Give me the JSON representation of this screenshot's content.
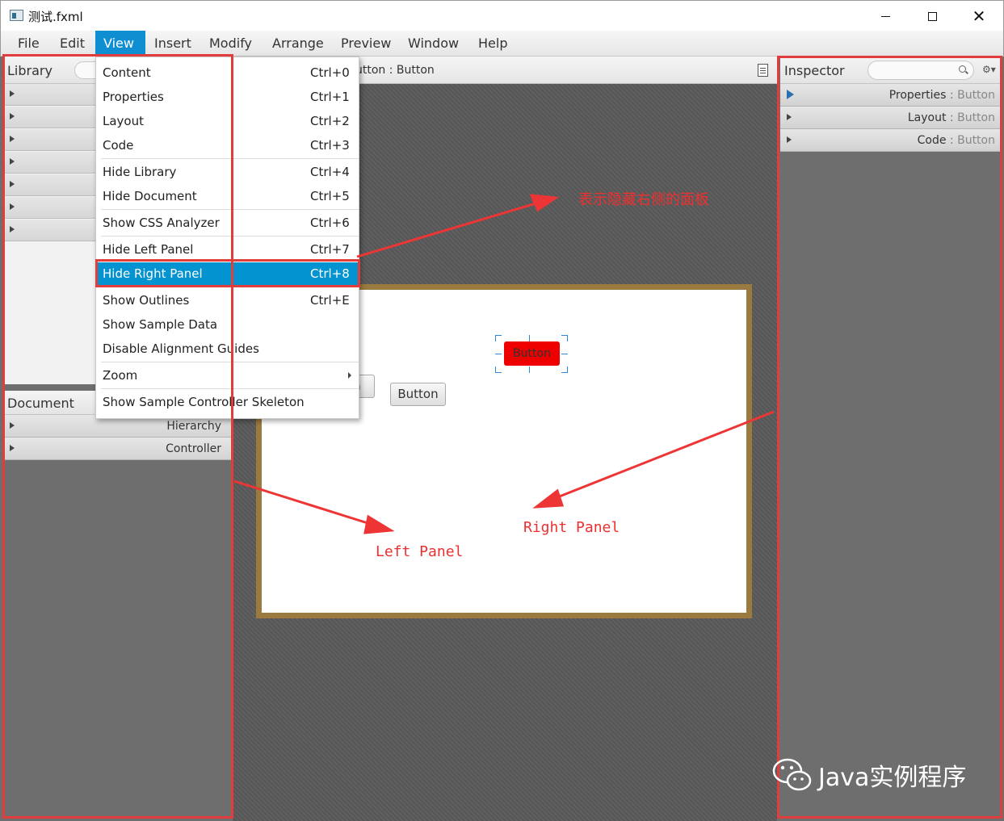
{
  "window": {
    "title": "测试.fxml"
  },
  "menubar": {
    "items": [
      {
        "label": "File"
      },
      {
        "label": "Edit"
      },
      {
        "label": "View"
      },
      {
        "label": "Insert"
      },
      {
        "label": "Modify"
      },
      {
        "label": "Arrange"
      },
      {
        "label": "Preview"
      },
      {
        "label": "Window"
      },
      {
        "label": "Help"
      }
    ],
    "active": "View"
  },
  "view_menu": {
    "items": [
      {
        "label": "Content",
        "shortcut": "Ctrl+0"
      },
      {
        "label": "Properties",
        "shortcut": "Ctrl+1"
      },
      {
        "label": "Layout",
        "shortcut": "Ctrl+2"
      },
      {
        "label": "Code",
        "shortcut": "Ctrl+3"
      },
      {
        "label": "Hide Library",
        "shortcut": "Ctrl+4"
      },
      {
        "label": "Hide Document",
        "shortcut": "Ctrl+5"
      },
      {
        "label": "Show CSS Analyzer",
        "shortcut": "Ctrl+6"
      },
      {
        "label": "Hide Left Panel",
        "shortcut": "Ctrl+7"
      },
      {
        "label": "Hide Right Panel",
        "shortcut": "Ctrl+8",
        "highlighted": true
      },
      {
        "label": "Show Outlines",
        "shortcut": "Ctrl+E"
      },
      {
        "label": "Show Sample Data",
        "shortcut": ""
      },
      {
        "label": "Disable Alignment Guides",
        "shortcut": ""
      },
      {
        "label": "Zoom",
        "shortcut": ""
      },
      {
        "label": "Show Sample Controller Skeleton",
        "shortcut": ""
      }
    ]
  },
  "left_panel": {
    "library_title": "Library",
    "document_title": "Document",
    "document_sections": [
      {
        "label": "Hierarchy"
      },
      {
        "label": "Controller"
      }
    ]
  },
  "center": {
    "breadcrumb": "utton : Button",
    "partial_button_label": "on",
    "button_label": "Button",
    "selected_button_label": "Button"
  },
  "right_panel": {
    "inspector_title": "Inspector",
    "sections": [
      {
        "name": "Properties",
        "sep": " : ",
        "type": "Button"
      },
      {
        "name": "Layout",
        "sep": " : ",
        "type": "Button"
      },
      {
        "name": "Code",
        "sep": " : ",
        "type": "Button"
      }
    ]
  },
  "annotations": {
    "hide_right_panel_note": "表示隐藏右侧的面板",
    "left_panel_label": "Left Panel",
    "right_panel_label": "Right Panel"
  },
  "watermark": {
    "text": "Java实例程序"
  },
  "colors": {
    "menu_highlight": "#0393d1",
    "active_menu": "#0f8fd1",
    "annotation_red": "#e23d3d",
    "selected_button": "#ee0000",
    "frame_border": "#9a7a3e"
  }
}
